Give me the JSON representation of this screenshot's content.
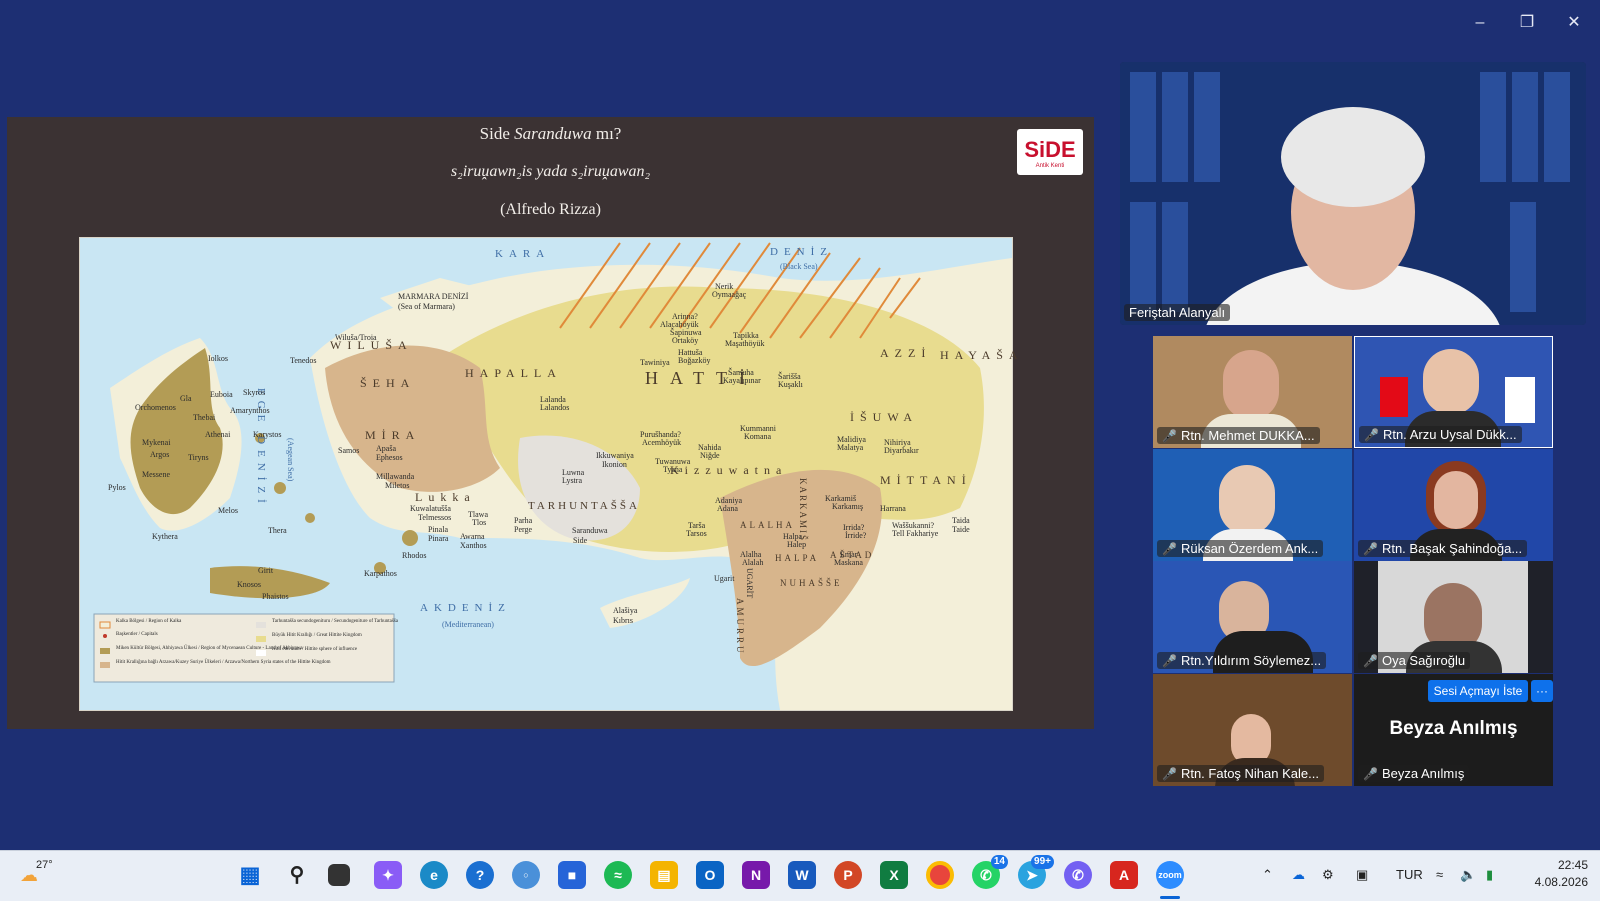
{
  "window": {
    "minimize_icon": "minimize-icon",
    "restore_icon": "restore-icon",
    "close_icon": "close-icon"
  },
  "slide": {
    "title_prefix": "Side ",
    "title_italic": "Saranduwa",
    "title_suffix": " mı?",
    "subtitle": "s₂iruṷawn₂is yada  s₂iruṷawan₂",
    "author": "(Alfredo Rizza)",
    "logo_text": "SiDE",
    "logo_sub": "Antik Kenti",
    "map": {
      "regions": [
        "WILUŠA",
        "HAPALLA",
        "ŠEHA",
        "MİRA",
        "HATTİ",
        "AZZİ",
        "HAYAŠA",
        "İŠUWA",
        "Lukka",
        "TARHUNTAŠŠA",
        "Kizzuwatna",
        "MİTTANİ",
        "KARKAMIŠ",
        "ALALHA",
        "HALPA",
        "AŠTAD",
        "NUHAŠŠE",
        "AMURRU",
        "UGARİT"
      ],
      "seas": [
        "KARA",
        "DENİZ",
        "(Black Sea)",
        "EGE DENİZİ",
        "(Aegean Sea)",
        "AKDENİZ",
        "(Mediterranean)",
        "MARMARA DENİZİ",
        "(Sea of Marmara)"
      ],
      "cities": [
        "Wiluša/Troia",
        "Tenedos",
        "Iolkos",
        "Euboia",
        "Skyros",
        "Gla",
        "Thebai",
        "Amarynthos",
        "Orchomenos",
        "Athenai",
        "Karystos",
        "Mykenai",
        "Argos",
        "Tiryns",
        "Messene",
        "Pylos",
        "Kythera",
        "Melos",
        "Thera",
        "Girit",
        "Knosos",
        "Phaistos",
        "Karpathos",
        "Rhodos",
        "Samos",
        "Apaša",
        "Ephesos",
        "Millawanda",
        "Miletos",
        "Kuwalatušša",
        "Telmessos",
        "Pinala",
        "Pinara",
        "Tlawa",
        "Tlos",
        "Awarna",
        "Xanthos",
        "Parha",
        "Perge",
        "Saranduwa",
        "Side",
        "Lalanda",
        "Lalandos",
        "Luwna",
        "Lystra",
        "Ikkuwaniya",
        "Ikonion",
        "Purušhanda?",
        "Acemhöyük",
        "Nahida",
        "Niğde",
        "Tuwanuwa",
        "Tyana",
        "Hattuša",
        "Boğazköy",
        "Tawiniya",
        "Šapinuwa",
        "Ortaköy",
        "Arinna?",
        "Alacahöyük",
        "Nerik",
        "Oymaağaç",
        "Tapikka",
        "Maşathöyük",
        "Šamuha",
        "Kayalıpınar",
        "Šarišša",
        "Kuşaklı",
        "Kummanni",
        "Komana",
        "Malidiya",
        "Malatya",
        "Nihiriya",
        "Diyarbakır",
        "Adaniya",
        "Adana",
        "Tarša",
        "Tarsos",
        "Karkamiš",
        "Karkamış",
        "Irrida?",
        "İrride?",
        "Harrana",
        "Waššukanni?",
        "Tell Fakhariye",
        "Taida",
        "Taide",
        "Halpa",
        "Halep",
        "Emar",
        "Maskana",
        "Alalha",
        "Alalah",
        "Ugarit",
        "Alašiya",
        "Kıbrıs"
      ],
      "legend": [
        "Kalka Bölgesi / Region of Kalka",
        "Başkentler / Capitals",
        "Miken Kültür Bölgesi, Ahhiyawa Ülkesi / Region of Mycenaean Culture - Land of Ahhiyawa",
        "Hitit Krallığına bağlı Arzawa/Kuzey Suriye Ülkeleri / Arzawa/Northern Syria states of the Hittite Kingdom",
        "Tarhuntašša secundogenituru / Secundogeniture of Tarhuntašša",
        "Büyük Hitit Krallığı / Great Hittite Kingdom",
        "Hitit etki alanı / Hittite sphere of influence"
      ]
    }
  },
  "speaker": {
    "name": "Feriştah Alanyalı"
  },
  "participants": [
    {
      "name": "Rtn. Mehmet DUKKA..."
    },
    {
      "name": "Rtn. Arzu Uysal Dükk..."
    },
    {
      "name": "Rüksan Özerdem Ank..."
    },
    {
      "name": "Rtn. Başak Şahindoğa..."
    },
    {
      "name": "Rtn.Yıldırım Söylemez..."
    },
    {
      "name": "Oya Sağıroğlu"
    },
    {
      "name": "Rtn. Fatoş Nihan Kale..."
    },
    {
      "name": "Beyza Anılmış",
      "display": "Beyza Anılmış"
    }
  ],
  "unmute_request_button": "Sesi Açmayı İste",
  "more_button": "···",
  "taskbar": {
    "weather": "27°",
    "apps": [
      "windows-start",
      "search",
      "task-view",
      "copilot",
      "edge",
      "help",
      "beta",
      "store",
      "spotify",
      "file-explorer",
      "outlook",
      "onenote",
      "word",
      "powerpoint",
      "excel",
      "chrome",
      "whatsapp",
      "telegram",
      "viber",
      "acrobat",
      "zoom"
    ],
    "whatsapp_badge": "14",
    "telegram_badge": "99+",
    "language": "TUR",
    "time": "22:45",
    "date": "4.08.2026"
  }
}
